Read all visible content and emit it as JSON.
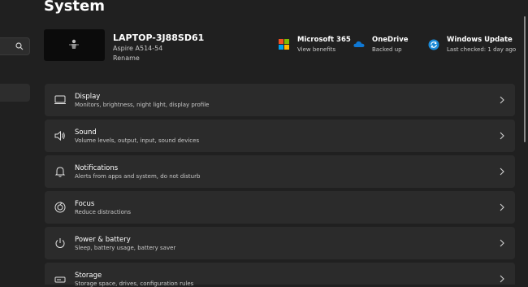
{
  "page": {
    "title": "System"
  },
  "device": {
    "name": "LAPTOP-3J88SD61",
    "model": "Aspire A514-54",
    "rename_label": "Rename"
  },
  "status": [
    {
      "title": "Microsoft 365",
      "subtitle": "View benefits",
      "icon": "microsoft-365-icon"
    },
    {
      "title": "OneDrive",
      "subtitle": "Backed up",
      "icon": "onedrive-icon"
    },
    {
      "title": "Windows Update",
      "subtitle": "Last checked: 1 day ago",
      "icon": "windows-update-icon"
    }
  ],
  "settings": [
    {
      "title": "Display",
      "subtitle": "Monitors, brightness, night light, display profile",
      "icon": "monitor-icon"
    },
    {
      "title": "Sound",
      "subtitle": "Volume levels, output, input, sound devices",
      "icon": "speaker-icon"
    },
    {
      "title": "Notifications",
      "subtitle": "Alerts from apps and system, do not disturb",
      "icon": "bell-icon"
    },
    {
      "title": "Focus",
      "subtitle": "Reduce distractions",
      "icon": "focus-icon"
    },
    {
      "title": "Power & battery",
      "subtitle": "Sleep, battery usage, battery saver",
      "icon": "power-icon"
    },
    {
      "title": "Storage",
      "subtitle": "Storage space, drives, configuration rules",
      "icon": "storage-icon"
    }
  ],
  "colors": {
    "background": "#202020",
    "card": "#2b2b2b",
    "accent": "#0a84d4"
  }
}
